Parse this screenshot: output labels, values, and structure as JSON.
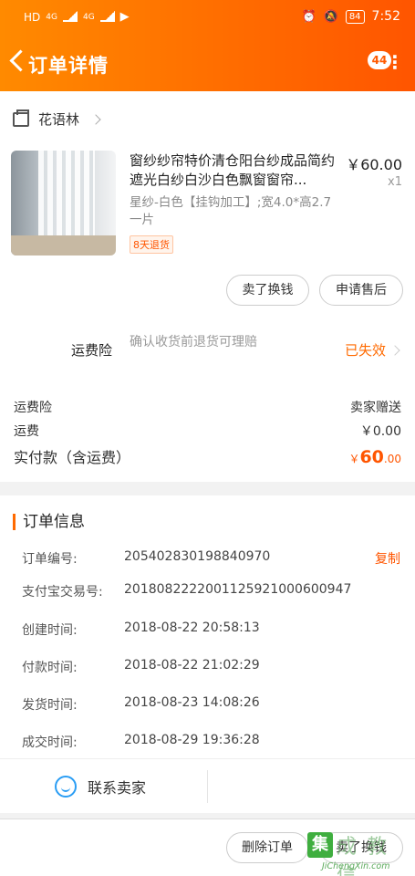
{
  "status_bar": {
    "network": "HD",
    "signal1": "4G",
    "signal2": "4G",
    "battery": "84",
    "time": "7:52"
  },
  "header": {
    "title": "订单详情",
    "notification_count": "44"
  },
  "shop": {
    "name": "花语林"
  },
  "product": {
    "name": "窗纱纱帘特价清仓阳台纱成品简约遮光白纱白沙白色飘窗窗帘...",
    "sku": "星纱-白色【挂钩加工】;宽4.0*高2.7一片",
    "tag": "8天退货",
    "price": "￥60.00",
    "quantity": "x1"
  },
  "item_actions": {
    "sell": "卖了换钱",
    "after_sale": "申请售后"
  },
  "insurance": {
    "label": "运费险",
    "desc": "确认收货前退货可理赔",
    "status": "已失效"
  },
  "summary": {
    "ins_label": "运费险",
    "ins_value": "卖家赠送",
    "ship_label": "运费",
    "ship_value": "￥0.00",
    "paid_label": "实付款（含运费）",
    "paid_currency": "￥",
    "paid_int": "60",
    "paid_dec": ".00"
  },
  "order_info": {
    "title": "订单信息",
    "copy": "复制",
    "rows": [
      {
        "label": "订单编号:",
        "value": "205402830198840970"
      },
      {
        "label": "支付宝交易号:",
        "value": "2018082222001125921000600947"
      },
      {
        "label": "创建时间:",
        "value": "2018-08-22 20:58:13"
      },
      {
        "label": "付款时间:",
        "value": "2018-08-22 21:02:29"
      },
      {
        "label": "发货时间:",
        "value": "2018-08-23 14:08:26"
      },
      {
        "label": "成交时间:",
        "value": "2018-08-29 19:36:28"
      }
    ]
  },
  "contact": {
    "label": "联系卖家"
  },
  "bottom": {
    "delete": "删除订单",
    "sell": "卖了换钱"
  },
  "watermark": {
    "box": "集",
    "big": "成 教 信",
    "url": "JiChengXin.com"
  },
  "colors": {
    "accent": "#ff6a00",
    "price": "#ff5500",
    "contact_icon": "#2a9df4"
  }
}
